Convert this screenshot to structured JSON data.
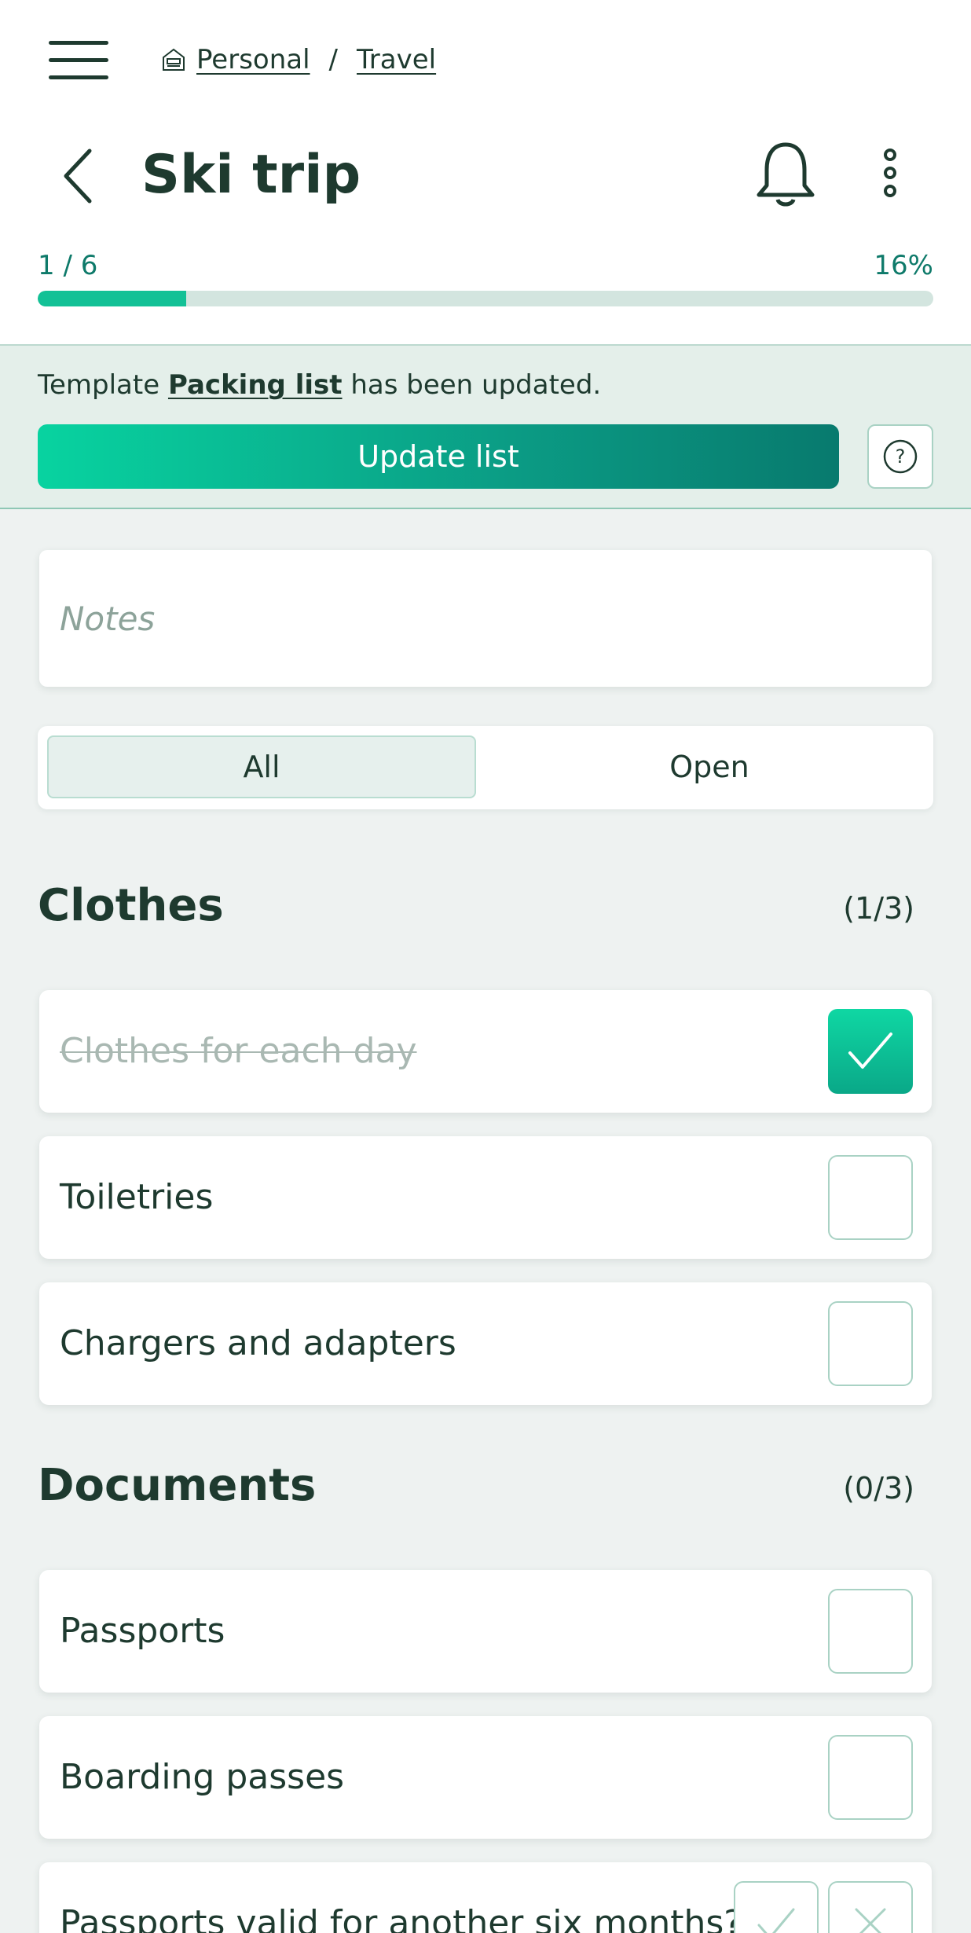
{
  "breadcrumb": {
    "items": [
      "Personal",
      "Travel"
    ],
    "separator": "/"
  },
  "page": {
    "title": "Ski trip"
  },
  "progress": {
    "count": "1 / 6",
    "percent_label": "16%",
    "fraction": 0.166
  },
  "banner": {
    "text_before": "Template",
    "link": "Packing list",
    "text_after": "has been updated.",
    "update_label": "Update list",
    "help_label": "?"
  },
  "notes": {
    "placeholder": "Notes",
    "value": ""
  },
  "filter": {
    "options": [
      "All",
      "Open"
    ],
    "selected": "All"
  },
  "sections": [
    {
      "title": "Clothes",
      "count": "(1/3)",
      "items": [
        {
          "label": "Clothes for each day",
          "checked": true
        },
        {
          "label": "Toiletries",
          "checked": false
        },
        {
          "label": "Chargers and adapters",
          "checked": false
        }
      ]
    },
    {
      "title": "Documents",
      "count": "(0/3)",
      "items": [
        {
          "label": "Passports",
          "checked": false
        },
        {
          "label": "Boarding passes",
          "checked": false
        },
        {
          "label": "Passports valid for another six months?",
          "type": "yes-no"
        }
      ]
    }
  ],
  "icons": {
    "menu": "hamburger-icon",
    "home": "home-icon",
    "back": "chevron-left-icon",
    "bell": "bell-icon",
    "more": "more-vertical-icon",
    "check": "checkmark-icon",
    "close": "x-icon"
  },
  "colors": {
    "accent": "#13c196",
    "text": "#1e3a2f",
    "link": "#0e7a6a",
    "background": "#eef2f1"
  }
}
